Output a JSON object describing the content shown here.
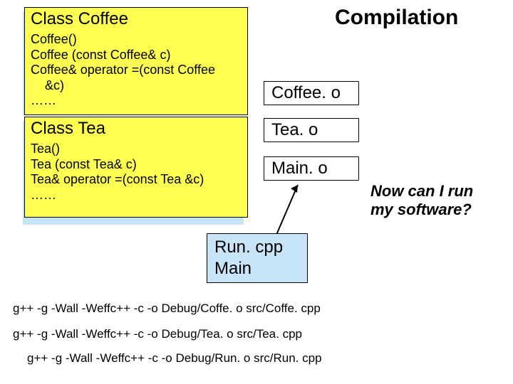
{
  "title": "Compilation",
  "coffee": {
    "class_title": "Class Coffee",
    "members": [
      "Coffee()",
      "Coffee (const Coffee& c)",
      "Coffee& operator =(const Coffee",
      "    &c)",
      "……"
    ]
  },
  "tea": {
    "class_title": "Class Tea",
    "members": [
      "Tea()",
      "Tea (const Tea& c)",
      "Tea& operator =(const Tea &c)",
      "……"
    ]
  },
  "outputs": {
    "coffee_o": "Coffee. o",
    "tea_o": "Tea. o",
    "main_o": "Main. o"
  },
  "question": {
    "line1": "Now can I run",
    "line2": "my software?"
  },
  "run": {
    "line1": "Run. cpp",
    "line2": "Main"
  },
  "commands": {
    "c1": "g++ -g -Wall -Weffc++ -c -o Debug/Coffe. o src/Coffe. cpp",
    "c2": "g++ -g -Wall -Weffc++ -c -o Debug/Tea. o src/Tea. cpp",
    "c3": "g++ -g -Wall -Weffc++ -c -o Debug/Run. o src/Run. cpp"
  }
}
